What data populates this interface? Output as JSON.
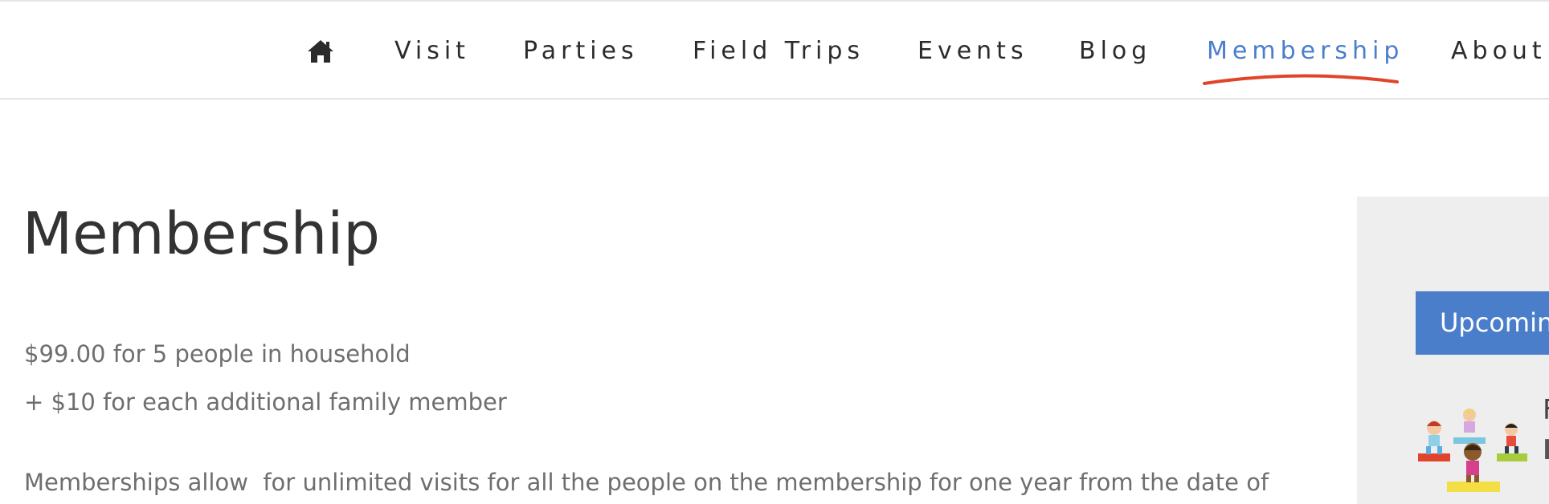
{
  "nav": {
    "home_icon": "home-icon",
    "items": [
      {
        "label": "Visit"
      },
      {
        "label": "Parties"
      },
      {
        "label": "Field Trips"
      },
      {
        "label": "Events"
      },
      {
        "label": "Blog"
      },
      {
        "label": "Membership",
        "active": true
      },
      {
        "label": "About"
      }
    ],
    "active_color": "#4a7ecb",
    "underline_color": "#e0452c"
  },
  "main": {
    "title": "Membership",
    "price_line": "$99.00 for 5 people in household",
    "additional_line": "+ $10 for each additional family member",
    "description": "Memberships allow  for unlimited visits for all the people on the membership for one year from the date of"
  },
  "sidebar": {
    "upcoming_label": "Upcoming",
    "event_image": "kids-yoga-illustration",
    "event_text_1": "F",
    "event_text_2": "F"
  }
}
